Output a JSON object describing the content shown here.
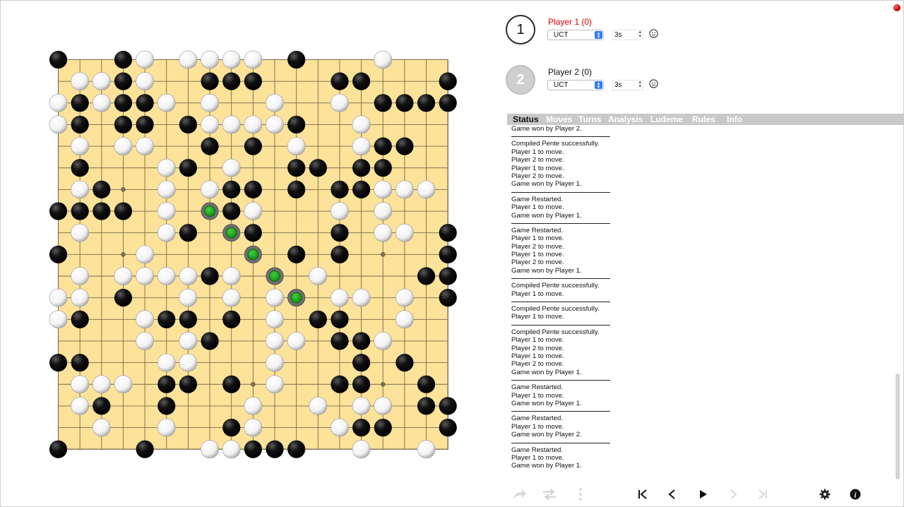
{
  "players": [
    {
      "number": "1",
      "name": "Player 1  (0)",
      "ai": "UCT",
      "time": "3s",
      "active": true
    },
    {
      "number": "2",
      "name": "Player 2  (0)",
      "ai": "UCT",
      "time": "3s",
      "active": false
    }
  ],
  "tabs": [
    "Status",
    "Moves",
    "Turns",
    "Analysis",
    "Ludeme",
    "Rules",
    "Info"
  ],
  "active_tab": "Status",
  "status_log": [
    [
      "Game won by Player 2."
    ],
    [
      "Compiled Pente successfully.",
      "Player 1 to move.",
      "Player 2 to move.",
      "Player 1 to move.",
      "Player 2 to move.",
      "Game won by Player 1."
    ],
    [
      "Game Restarted.",
      "Player 1 to move.",
      "Game won by Player 1."
    ],
    [
      "Game Restarted.",
      "Player 1 to move.",
      "Player 2 to move.",
      "Player 1 to move.",
      "Player 2 to move.",
      "Game won by Player 1."
    ],
    [
      "Compiled Pente successfully.",
      "Player 1 to move."
    ],
    [
      "Compiled Pente successfully.",
      "Player 1 to move."
    ],
    [
      "Compiled Pente successfully.",
      "Player 1 to move.",
      "Player 2 to move.",
      "Player 1 to move.",
      "Player 2 to move.",
      "Game won by Player 1."
    ],
    [
      "Game Restarted.",
      "Player 1 to move.",
      "Game won by Player 1."
    ],
    [
      "Game Restarted.",
      "Player 1 to move.",
      "Game won by Player 2."
    ],
    [
      "Game Restarted.",
      "Player 1 to move.",
      "Game won by Player 1."
    ]
  ],
  "board": {
    "game": "Pente",
    "size": 19,
    "colors": {
      "board": "#fde29a",
      "line": "#7a6a45",
      "black": "#000000",
      "white": "#ffffff",
      "highlight": "#1aa31a",
      "active_player": "#e00000",
      "accent": "#2f7cf6"
    },
    "hoshi": [
      [
        3,
        9
      ],
      [
        6,
        3
      ],
      [
        6,
        15
      ],
      [
        9,
        3
      ],
      [
        9,
        9
      ],
      [
        9,
        15
      ],
      [
        15,
        3
      ],
      [
        15,
        9
      ],
      [
        15,
        15
      ]
    ],
    "highlighted": [
      [
        7,
        7
      ],
      [
        8,
        8
      ],
      [
        9,
        9
      ],
      [
        10,
        10
      ],
      [
        11,
        11
      ]
    ],
    "rows": [
      "B..BW.WWWW.B...W...",
      ".WWBW..BBB...BB...B",
      "WBWBBW.W..W..W.BBBB",
      "WB.BB.BWWWWB..W....",
      ".W.WW..B.B.W..WBB..",
      ".B...WB.W..BB.BB...",
      ".WB..W.WBB.B.BBWWW.",
      "BBBB.W.GBW...W.W...",
      ".W...WBG.B...B.WW.B",
      "B...W.....GB.B....BB",
      ".W.WWWWBW.G.W....BBBB",
      "WW.B..W.W.WG.WW.W.B",
      "WB..WBB.B.W.BB..W..",
      "....W.WB..WW.BBW....",
      "BB...WW...W...B.B..W",
      ".WWW.BB.B.W..BB..B.",
      ".WB..B...W..W.WW.BB",
      "..W..W..BW...WBB..B",
      "B...B..WWBBB..W..W.."
    ]
  },
  "toolbar": [
    "redo-arrow-icon",
    "swap-arrows-icon",
    "more-vertical-icon",
    "first-move-icon",
    "previous-move-icon",
    "play-icon",
    "next-move-icon",
    "last-move-icon",
    "settings-gear-icon",
    "info-icon"
  ]
}
